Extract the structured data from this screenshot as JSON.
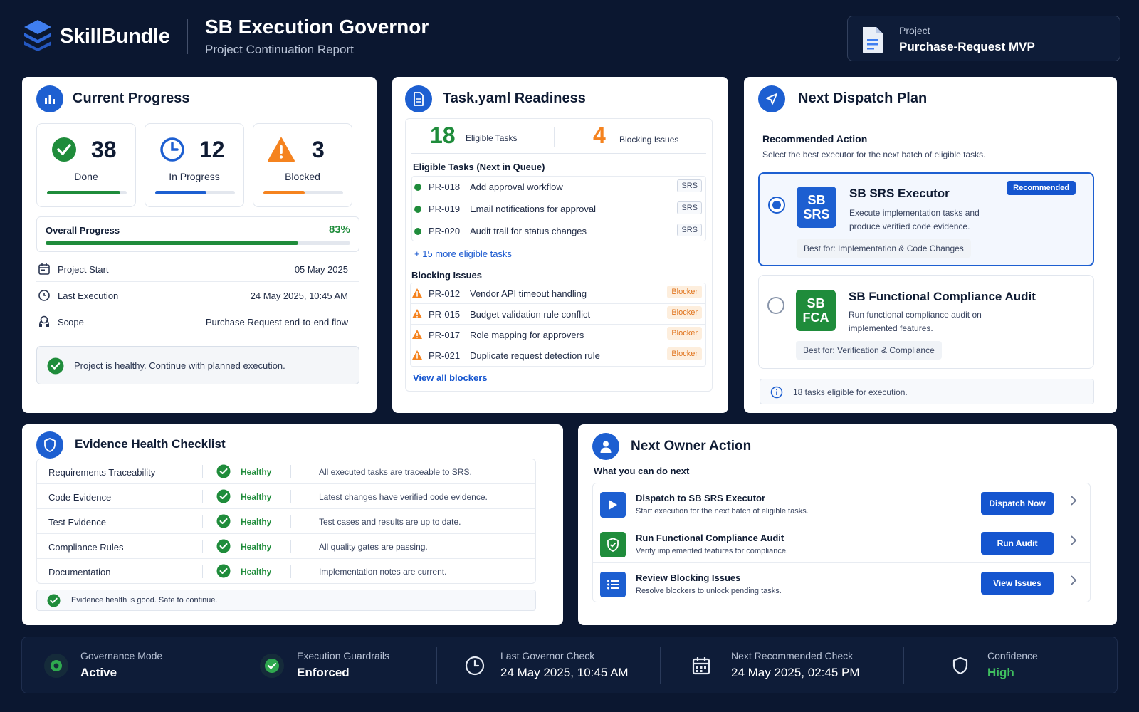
{
  "brand": {
    "name": "SkillBundle"
  },
  "header": {
    "title": "SB Execution Governor",
    "subtitle": "Project Continuation Report",
    "project_label": "Project",
    "project_name": "Purchase-Request MVP"
  },
  "colors": {
    "accent": "#1d5fd1",
    "success": "#1f8c3b",
    "warning": "#f5831f",
    "background": "#0b1730"
  },
  "progress": {
    "title": "Current Progress",
    "stats": [
      {
        "value": "38",
        "label": "Done",
        "progress": 0.92,
        "color": "#1f8c3b",
        "icon": "check-circle-icon"
      },
      {
        "value": "12",
        "label": "In Progress",
        "progress": 0.64,
        "color": "#1d5fd1",
        "icon": "clock-icon"
      },
      {
        "value": "3",
        "label": "Blocked",
        "progress": 0.52,
        "color": "#f5831f",
        "icon": "warning-icon"
      }
    ],
    "overall_label": "Overall Progress",
    "overall_value": "83%",
    "overall_fraction": 0.83,
    "details": [
      {
        "label": "Project Start",
        "value": "05 May 2025",
        "icon": "calendar-icon"
      },
      {
        "label": "Last Execution",
        "value": "24 May 2025, 10:45 AM",
        "icon": "clock-icon"
      },
      {
        "label": "Scope",
        "value": "Purchase Request end-to-end flow",
        "icon": "scope-icon"
      }
    ],
    "health_message": "Project is healthy. Continue with planned execution."
  },
  "readiness": {
    "title": "Task.yaml Readiness",
    "eligible_count": "18",
    "eligible_label": "Eligible Tasks",
    "blocking_count": "4",
    "blocking_label": "Blocking Issues",
    "eligible_heading": "Eligible Tasks (Next in Queue)",
    "eligible_tasks": [
      {
        "id": "PR-018",
        "title": "Add approval workflow",
        "tag": "SRS"
      },
      {
        "id": "PR-019",
        "title": "Email notifications for approval",
        "tag": "SRS"
      },
      {
        "id": "PR-020",
        "title": "Audit trail for status changes",
        "tag": "SRS"
      }
    ],
    "more_link": "+ 15 more eligible tasks",
    "blocking_heading": "Blocking Issues",
    "blockers": [
      {
        "id": "PR-012",
        "title": "Vendor API timeout handling",
        "tag": "Blocker"
      },
      {
        "id": "PR-015",
        "title": "Budget validation rule conflict",
        "tag": "Blocker"
      },
      {
        "id": "PR-017",
        "title": "Role mapping for approvers",
        "tag": "Blocker"
      },
      {
        "id": "PR-021",
        "title": "Duplicate request detection rule",
        "tag": "Blocker"
      }
    ],
    "view_all": "View all blockers"
  },
  "dispatch": {
    "title": "Next Dispatch Plan",
    "rec_heading": "Recommended Action",
    "rec_sub": "Select the best executor for the next batch of eligible tasks.",
    "executors": [
      {
        "logo_top": "SB",
        "logo_bottom": "SRS",
        "name": "SB SRS Executor",
        "desc": "Execute implementation tasks and produce verified code evidence.",
        "best_for": "Best for:  Implementation & Code Changes",
        "badge": "Recommended",
        "selected": true,
        "color": "#1d5fd1"
      },
      {
        "logo_top": "SB",
        "logo_bottom": "FCA",
        "name": "SB Functional Compliance Audit",
        "desc": "Run functional compliance audit on implemented features.",
        "best_for": "Best for:  Verification & Compliance",
        "selected": false,
        "color": "#1f8c3b"
      }
    ],
    "info": "18 tasks eligible for execution."
  },
  "evidence": {
    "title": "Evidence Health Checklist",
    "rows": [
      {
        "name": "Requirements Traceability",
        "status": "Healthy",
        "desc": "All executed tasks are traceable to SRS."
      },
      {
        "name": "Code Evidence",
        "status": "Healthy",
        "desc": "Latest changes have verified code evidence."
      },
      {
        "name": "Test Evidence",
        "status": "Healthy",
        "desc": "Test cases and results are up to date."
      },
      {
        "name": "Compliance Rules",
        "status": "Healthy",
        "desc": "All quality gates are passing."
      },
      {
        "name": "Documentation",
        "status": "Healthy",
        "desc": "Implementation notes are current."
      }
    ],
    "summary": "Evidence health is good. Safe to continue."
  },
  "owner": {
    "title": "Next Owner Action",
    "subtitle": "What you can do next",
    "actions": [
      {
        "title": "Dispatch to SB SRS Executor",
        "desc": "Start execution for the next batch of eligible tasks.",
        "button": "Dispatch Now",
        "icon": "play-icon",
        "color": "#1d5fd1"
      },
      {
        "title": "Run Functional Compliance Audit",
        "desc": "Verify implemented features for compliance.",
        "button": "Run Audit",
        "icon": "shield-check-icon",
        "color": "#1f8c3b"
      },
      {
        "title": "Review Blocking Issues",
        "desc": "Resolve blockers to unlock pending tasks.",
        "button": "View Issues",
        "icon": "list-icon",
        "color": "#1d5fd1"
      }
    ]
  },
  "footer": [
    {
      "label": "Governance Mode",
      "value": "Active",
      "icon": "status-dot-icon"
    },
    {
      "label": "Execution Guardrails",
      "value": "Enforced",
      "icon": "check-circle-icon"
    },
    {
      "label": "Last Governor Check",
      "value": "24 May 2025, 10:45 AM",
      "icon": "clock-icon"
    },
    {
      "label": "Next Recommended Check",
      "value": "24 May 2025, 02:45 PM",
      "icon": "calendar-icon"
    },
    {
      "label": "Confidence",
      "value": "High",
      "icon": "shield-icon",
      "value_color": "#3fbf5f"
    }
  ]
}
